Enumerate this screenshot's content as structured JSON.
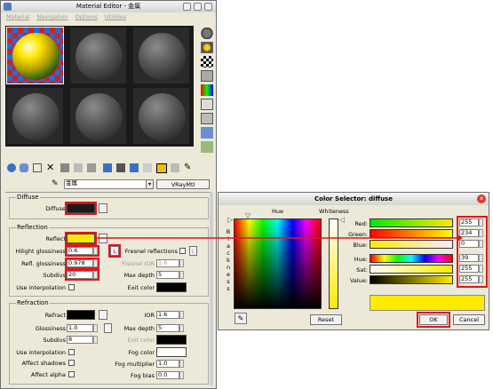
{
  "material_editor": {
    "title": "Material Editor - 金属",
    "menu": [
      "Material",
      "Navigation",
      "Options",
      "Utilities"
    ],
    "material_name": "金属",
    "material_type": "VRayMtl",
    "diffuse": {
      "section": "Diffuse",
      "label": "Diffuse",
      "color": "#1a1a1a"
    },
    "reflection": {
      "section": "Reflection",
      "reflect_label": "Reflect",
      "reflect_color": "#ffe600",
      "hilight_label": "Hilight glossiness",
      "hilight_value": "0.6",
      "refl_gloss_label": "Refl. glossiness",
      "refl_gloss_value": "0.978",
      "subdivs_label": "Subdivs",
      "subdivs_value": "20",
      "use_interp_label": "Use interpolation",
      "lock_label": "L",
      "fresnel_label": "Fresnel reflections",
      "fresnel_lock": "L",
      "fresnel_ior_label": "Fresnel IOR",
      "fresnel_ior_value": "1.6",
      "max_depth_label": "Max depth",
      "max_depth_value": "5",
      "exit_color_label": "Exit color",
      "exit_color": "#000000"
    },
    "refraction": {
      "section": "Refraction",
      "refract_label": "Refract",
      "refract_color": "#000000",
      "glossiness_label": "Glossiness",
      "glossiness_value": "1.0",
      "subdivs_label": "Subdivs",
      "subdivs_value": "8",
      "use_interp_label": "Use interpolation",
      "affect_shadows_label": "Affect shadows",
      "affect_alpha_label": "Affect alpha",
      "ior_label": "IOR",
      "ior_value": "1.6",
      "max_depth_label": "Max depth",
      "max_depth_value": "5",
      "exit_color_label": "Exit color",
      "exit_color": "#000000",
      "fog_color_label": "Fog color",
      "fog_color": "#ffffff",
      "fog_mult_label": "Fog multiplier",
      "fog_mult_value": "1.0",
      "fog_bias_label": "Fog bias",
      "fog_bias_value": "0.0"
    }
  },
  "color_selector": {
    "title": "Color Selector: diffuse",
    "hue_label": "Hue",
    "whiteness_label": "Whiteness",
    "blackness_label": "B\nl\na\nc\nk\nn\ne\ns\ns",
    "red_label": "Red:",
    "red_value": "255",
    "green_label": "Green:",
    "green_value": "234",
    "blue_label": "Blue:",
    "blue_value": "0",
    "hue_field_label": "Hue:",
    "hue_value": "39",
    "sat_label": "Sat:",
    "sat_value": "255",
    "value_label": "Value:",
    "value_value": "255",
    "reset_label": "Reset",
    "ok_label": "OK",
    "cancel_label": "Cancel",
    "preview_color": "#ffea00"
  }
}
